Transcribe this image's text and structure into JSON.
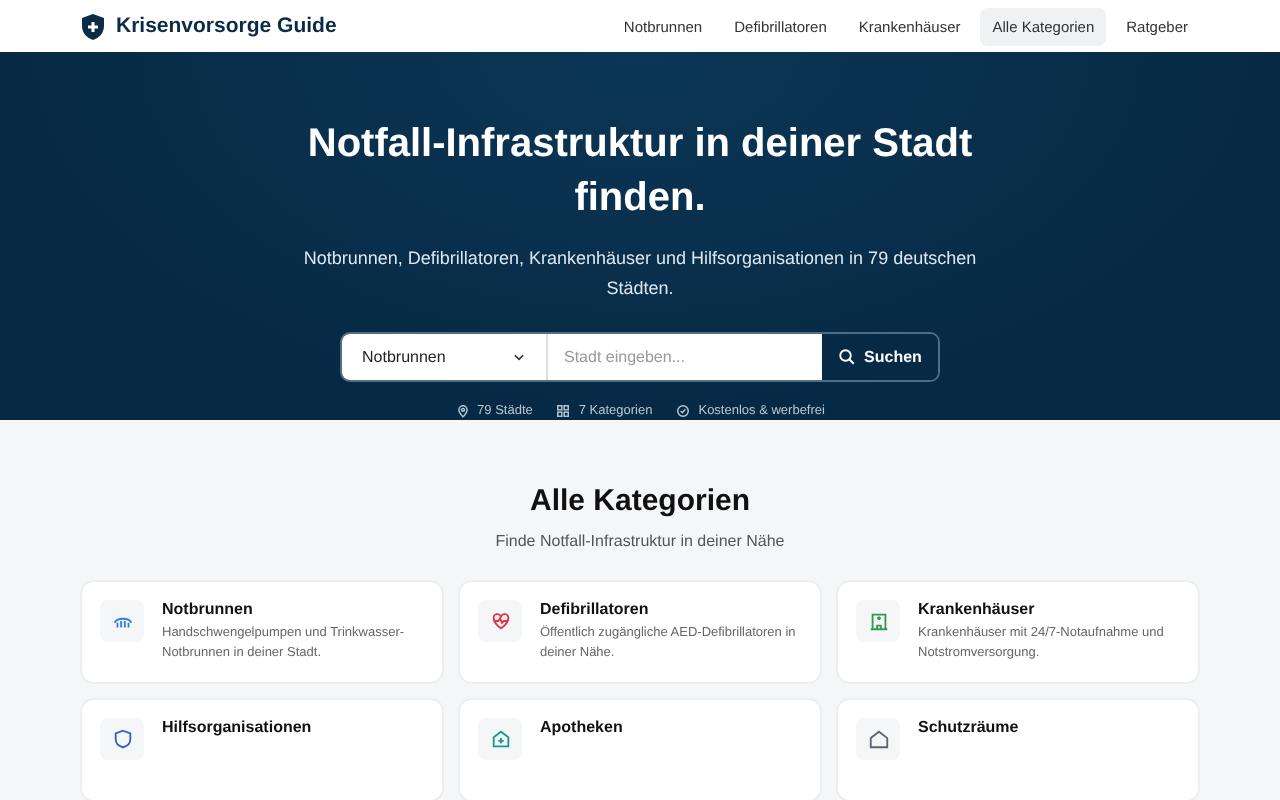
{
  "nav": {
    "brand": "Krisenvorsorge Guide",
    "links": [
      {
        "label": "Notbrunnen",
        "selected": false
      },
      {
        "label": "Defibrillatoren",
        "selected": false
      },
      {
        "label": "Krankenhäuser",
        "selected": false
      },
      {
        "label": "Alle Kategorien",
        "selected": true
      },
      {
        "label": "Ratgeber",
        "selected": false
      }
    ]
  },
  "hero": {
    "title": "Notfall-Infrastruktur in deiner Stadt finden.",
    "subtitle": "Notbrunnen, Defibrillatoren, Krankenhäuser und Hilfsorganisationen in 79 deutschen Städten.",
    "search": {
      "category": "Notbrunnen",
      "placeholder": "Stadt eingeben...",
      "button": "Suchen"
    },
    "facts": [
      {
        "kind": "pin",
        "text": "79 Städte"
      },
      {
        "kind": "grid",
        "text": "7 Kategorien"
      },
      {
        "kind": "check",
        "text": "Kostenlos & werbefrei"
      }
    ]
  },
  "section": {
    "title": "Alle Kategorien",
    "subtitle": "Finde Notfall-Infrastruktur in deiner Nähe",
    "cards": [
      {
        "kind": "water",
        "color": "#2f7fd8",
        "title": "Notbrunnen",
        "text": "Handschwengelpumpen und Trinkwasser-Notbrunnen in deiner Stadt."
      },
      {
        "kind": "heart",
        "color": "#e0323f",
        "title": "Defibrillatoren",
        "text": "Öffentlich zugängliche AED-Defibrillatoren in deiner Nähe."
      },
      {
        "kind": "hospital",
        "color": "#2f9a4a",
        "title": "Krankenhäuser",
        "text": "Krankenhäuser mit 24/7-Notaufnahme und Notstromversorgung."
      },
      {
        "kind": "shield",
        "color": "#2f5fc8",
        "title": "Hilfsorganisationen"
      },
      {
        "kind": "pharmacy",
        "color": "#1a9a8a",
        "title": "Apotheken"
      },
      {
        "kind": "shelter",
        "color": "#5a6470",
        "title": "Schutzräume"
      }
    ]
  }
}
